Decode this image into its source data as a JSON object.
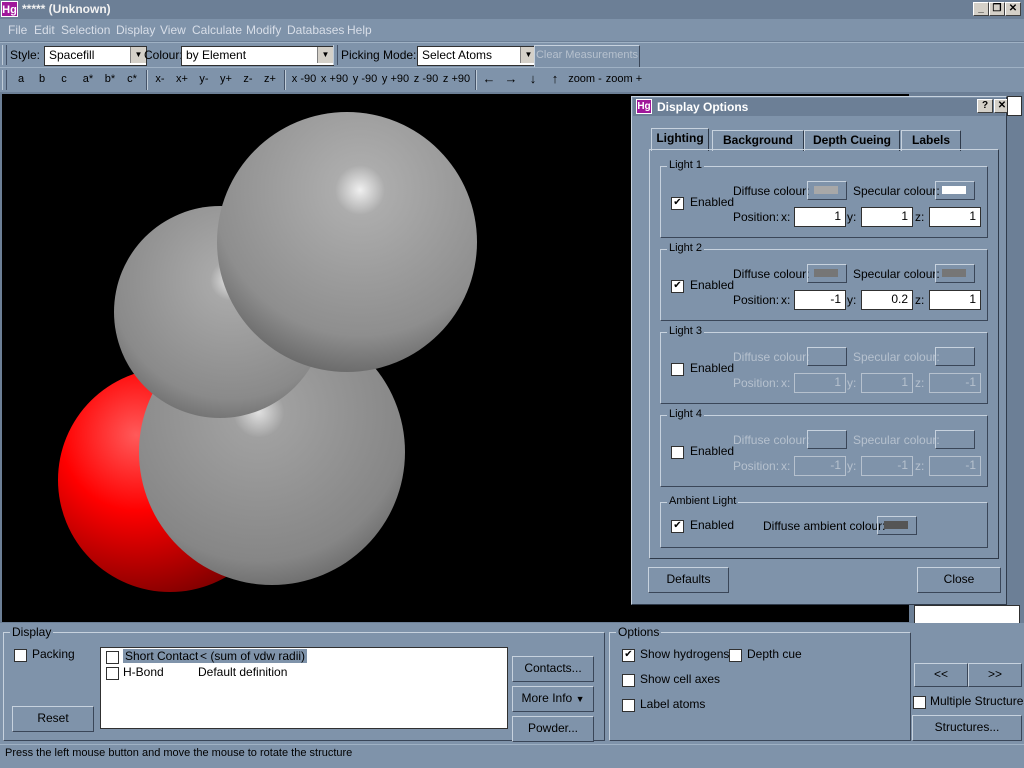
{
  "window": {
    "logo": "Hg",
    "title": "***** (Unknown)"
  },
  "menu": [
    "File",
    "Edit",
    "Selection",
    "Display",
    "View",
    "Calculate",
    "Modify",
    "Databases",
    "Help"
  ],
  "toolbar1": {
    "style_label": "Style:",
    "style_value": "Spacefill",
    "colour_label": "Colour:",
    "colour_value": "by Element",
    "picking_label": "Picking Mode:",
    "picking_value": "Select Atoms",
    "clear_label": "Clear Measurements"
  },
  "toolbar2": {
    "axes": [
      "a",
      "b",
      "c",
      "a*",
      "b*",
      "c*"
    ],
    "views": [
      "x-",
      "x+",
      "y-",
      "y+",
      "z-",
      "z+"
    ],
    "rotations": [
      "x -90",
      "x +90",
      "y -90",
      "y +90",
      "z -90",
      "z +90"
    ],
    "arrows": [
      "←",
      "→",
      "↓",
      "↑"
    ],
    "zoom_out": "zoom -",
    "zoom_in": "zoom +"
  },
  "dialog": {
    "logo": "Hg",
    "title": "Display Options",
    "help": "?",
    "close_x": "✕",
    "tabs": [
      "Lighting",
      "Background",
      "Depth Cueing",
      "Labels"
    ],
    "lights": [
      {
        "name": "Light 1",
        "enabled": true,
        "diffuse_label": "Diffuse colour:",
        "specular_label": "Specular colour:",
        "diffuse": "#a8a8a8",
        "specular": "#ffffff",
        "position_label": "Position:",
        "x": "1",
        "y": "1",
        "z": "1"
      },
      {
        "name": "Light 2",
        "enabled": true,
        "diffuse_label": "Diffuse colour:",
        "specular_label": "Specular colour:",
        "diffuse": "#767676",
        "specular": "#767676",
        "position_label": "Position:",
        "x": "-1",
        "y": "0.2",
        "z": "1"
      },
      {
        "name": "Light 3",
        "enabled": false,
        "diffuse_label": "Diffuse colour:",
        "specular_label": "Specular colour:",
        "diffuse": "#7f93aa",
        "specular": "#7f93aa",
        "position_label": "Position:",
        "x": "1",
        "y": "1",
        "z": "-1"
      },
      {
        "name": "Light 4",
        "enabled": false,
        "diffuse_label": "Diffuse colour:",
        "specular_label": "Specular colour:",
        "diffuse": "#7f93aa",
        "specular": "#7f93aa",
        "position_label": "Position:",
        "x": "-1",
        "y": "-1",
        "z": "-1"
      }
    ],
    "ambient": {
      "name": "Ambient Light",
      "enabled": true,
      "label": "Diffuse ambient colour:",
      "color": "#555555"
    },
    "enabled_label": "Enabled",
    "defaults": "Defaults",
    "close": "Close"
  },
  "display_panel": {
    "title": "Display",
    "packing": "Packing",
    "reset": "Reset",
    "list": [
      {
        "name": "Short Contact",
        "def": "< (sum of vdw radii)"
      },
      {
        "name": "H-Bond",
        "def": "Default definition"
      }
    ],
    "contacts": "Contacts...",
    "more_info": "More Info",
    "powder": "Powder..."
  },
  "options_panel": {
    "title": "Options",
    "show_hydrogens": "Show hydrogens",
    "depth_cue": "Depth cue",
    "show_cell_axes": "Show cell axes",
    "label_atoms": "Label atoms"
  },
  "structures": {
    "prev": "<<",
    "next": ">>",
    "multiple": "Multiple Structures",
    "button": "Structures..."
  },
  "status": "Press the left mouse button and move the mouse to rotate the structure",
  "molecule": {
    "atoms": [
      {
        "element": "C",
        "color": "#9a9a9a"
      },
      {
        "element": "C",
        "color": "#9a9a9a"
      },
      {
        "element": "C",
        "color": "#9a9a9a"
      },
      {
        "element": "O",
        "color": "#ff0000"
      }
    ]
  }
}
